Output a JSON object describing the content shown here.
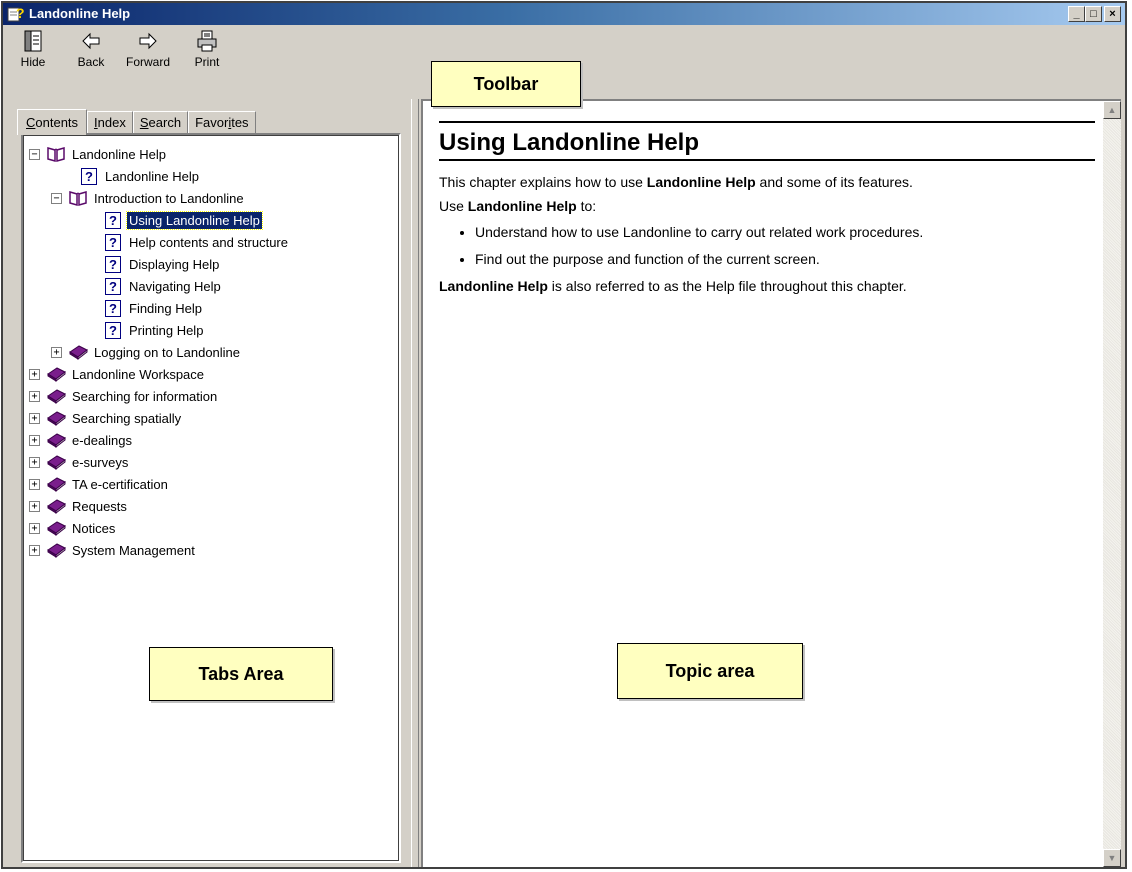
{
  "window": {
    "title": "Landonline Help",
    "minimize_glyph": "_",
    "maximize_glyph": "□",
    "close_glyph": "×"
  },
  "toolbar": {
    "buttons": [
      {
        "label": "Hide",
        "icon": "hide-pane-icon"
      },
      {
        "label": "Back",
        "icon": "back-arrow-icon"
      },
      {
        "label": "Forward",
        "icon": "forward-arrow-icon"
      },
      {
        "label": "Print",
        "icon": "printer-icon"
      }
    ]
  },
  "annotations": {
    "toolbar": "Toolbar",
    "tabs_area": "Tabs Area",
    "topic_area": "Topic area"
  },
  "tabs": [
    {
      "label": "Contents",
      "underline": "C",
      "rest": "ontents",
      "active": true
    },
    {
      "label": "Index",
      "underline": "I",
      "rest": "ndex",
      "active": false
    },
    {
      "label": "Search",
      "underline": "S",
      "rest": "earch",
      "active": false
    },
    {
      "label": "Favorites",
      "pre": "Favor",
      "underline": "i",
      "rest": "tes",
      "active": false
    }
  ],
  "tree": [
    {
      "label": "Landonline Help",
      "level": 0,
      "type": "open-book",
      "expander": "−"
    },
    {
      "label": "Landonline Help",
      "level": 1,
      "type": "topic"
    },
    {
      "label": "Introduction to Landonline",
      "level": 1,
      "type": "open-book",
      "expander": "−"
    },
    {
      "label": "Using Landonline Help",
      "level": 2,
      "type": "topic",
      "selected": true
    },
    {
      "label": "Help contents and structure",
      "level": 2,
      "type": "topic"
    },
    {
      "label": "Displaying Help",
      "level": 2,
      "type": "topic"
    },
    {
      "label": "Navigating Help",
      "level": 2,
      "type": "topic"
    },
    {
      "label": "Finding Help",
      "level": 2,
      "type": "topic"
    },
    {
      "label": "Printing Help",
      "level": 2,
      "type": "topic"
    },
    {
      "label": "Logging on to Landonline",
      "level": 1,
      "type": "closed-book",
      "expander": "+"
    },
    {
      "label": "Landonline Workspace",
      "level": 0,
      "type": "closed-book",
      "expander": "+"
    },
    {
      "label": "Searching for information",
      "level": 0,
      "type": "closed-book",
      "expander": "+"
    },
    {
      "label": "Searching spatially",
      "level": 0,
      "type": "closed-book",
      "expander": "+"
    },
    {
      "label": "e-dealings",
      "level": 0,
      "type": "closed-book",
      "expander": "+"
    },
    {
      "label": "e-surveys",
      "level": 0,
      "type": "closed-book",
      "expander": "+"
    },
    {
      "label": "TA e-certification",
      "level": 0,
      "type": "closed-book",
      "expander": "+"
    },
    {
      "label": "Requests",
      "level": 0,
      "type": "closed-book",
      "expander": "+"
    },
    {
      "label": "Notices",
      "level": 0,
      "type": "closed-book",
      "expander": "+"
    },
    {
      "label": "System Management",
      "level": 0,
      "type": "closed-book",
      "expander": "+"
    }
  ],
  "topic": {
    "heading": "Using Landonline Help",
    "p1_pre": "This chapter explains how to use ",
    "p1_bold": "Landonline Help",
    "p1_post": " and some of its features.",
    "p2_pre": "Use ",
    "p2_bold": "Landonline Help",
    "p2_post": " to:",
    "bullets": [
      "Understand how to use Landonline to carry out related work procedures.",
      "Find out the purpose and function of the current screen."
    ],
    "p3_bold": "Landonline Help",
    "p3_post": " is also referred to as the Help file throughout this chapter."
  },
  "scrollbar": {
    "up_glyph": "▲",
    "down_glyph": "▼"
  }
}
